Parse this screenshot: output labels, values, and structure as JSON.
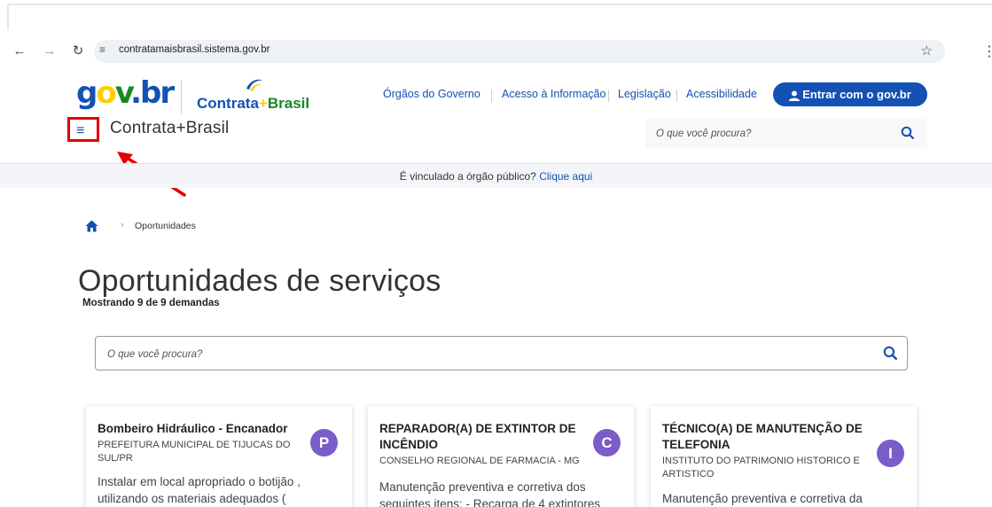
{
  "browser": {
    "url": "contratamaisbrasil.sistema.gov.br"
  },
  "header": {
    "logo_gov": {
      "g": "g",
      "o": "o",
      "v": "v",
      "dot": ".",
      "b": "br"
    },
    "logo_contrata": {
      "contrata": "Contrata",
      "plus": "+",
      "brasil": "Brasil"
    },
    "links": [
      "Órgãos do Governo",
      "Acesso à Informação",
      "Legislação",
      "Acessibilidade"
    ],
    "login_label": "Entrar com o gov.br",
    "site_title": "Contrata+Brasil",
    "search_placeholder": "O que você procura?"
  },
  "notice": {
    "text": "É vinculado a órgão público? ",
    "link": "Clique aqui"
  },
  "breadcrumb": {
    "current": "Oportunidades"
  },
  "main": {
    "title": "Oportunidades de serviços",
    "count_text": "Mostrando 9 de 9 demandas",
    "search_placeholder": "O que você procura?"
  },
  "cards": [
    {
      "title": "Bombeiro Hidráulico - Encanador",
      "org": "PREFEITURA MUNICIPAL DE TIJUCAS DO SUL/PR",
      "desc": "Instalar em local apropriado o botijão , utilizando os materiais adequados (",
      "badge": "P"
    },
    {
      "title": "REPARADOR(A) DE EXTINTOR DE INCÊNDIO",
      "org": "CONSELHO REGIONAL DE FARMACIA - MG",
      "desc": "Manutenção preventiva e corretiva dos seguintes itens: - Recarga de 4 extintores",
      "badge": "C"
    },
    {
      "title": "TÉCNICO(A) DE MANUTENÇÃO DE TELEFONIA",
      "org": "INSTITUTO DO PATRIMONIO HISTORICO E ARTISTICO",
      "desc": "Manutenção preventiva e corretiva da",
      "badge": "I"
    }
  ],
  "colors": {
    "primary": "#1351b4",
    "badge": "#7b5cc9",
    "annotation": "#e00000"
  }
}
